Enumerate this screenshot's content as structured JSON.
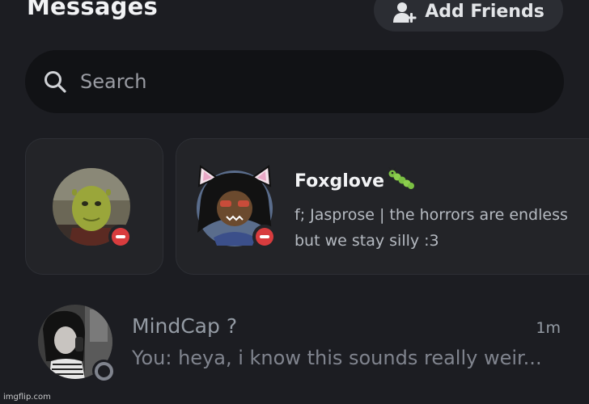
{
  "header": {
    "title": "Messages",
    "add_friends_label": "Add Friends",
    "add_friends_icon": "add-person-icon"
  },
  "search": {
    "placeholder": "Search",
    "icon": "search-icon"
  },
  "active_cards": [
    {
      "avatar": "green ogre avatar",
      "status": "do-not-disturb",
      "status_color": "#d83c3e"
    },
    {
      "avatar": "cat-eared troll avatar",
      "status": "do-not-disturb",
      "status_color": "#d83c3e",
      "name": "Foxglove",
      "name_emoji": "caterpillar",
      "status_line_1": "f; Jasprose | the horrors are endless",
      "status_line_2": "but we stay silly :3"
    }
  ],
  "direct_messages": [
    {
      "name": "MindCap ?",
      "time": "1m",
      "preview": "You: heya, i know this sounds really weir...",
      "status": "offline"
    }
  ],
  "watermark": "imgflip.com",
  "colors": {
    "background": "#1c1d22",
    "card": "#232428",
    "search_bg": "#111215",
    "dnd_red": "#d83c3e",
    "muted_text": "#949ba4"
  }
}
